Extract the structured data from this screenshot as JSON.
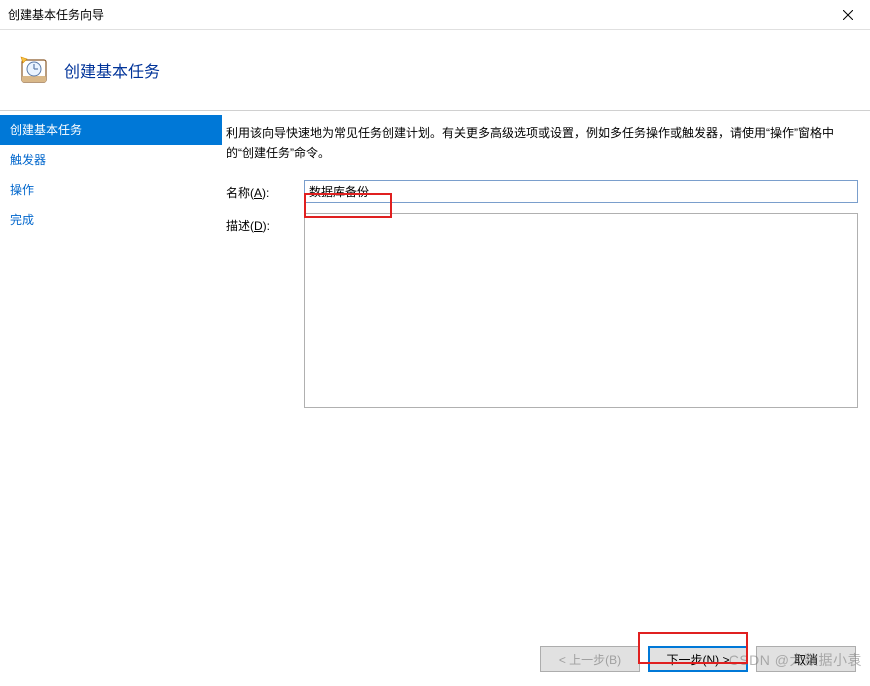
{
  "window": {
    "title": "创建基本任务向导"
  },
  "header": {
    "title": "创建基本任务"
  },
  "sidebar": {
    "items": [
      {
        "label": "创建基本任务"
      },
      {
        "label": "触发器"
      },
      {
        "label": "操作"
      },
      {
        "label": "完成"
      }
    ]
  },
  "main": {
    "intro": "利用该向导快速地为常见任务创建计划。有关更多高级选项或设置，例如多任务操作或触发器，请使用“操作”窗格中的“创建任务”命令。",
    "nameLabelPrefix": "名称(",
    "nameLabelKey": "A",
    "nameLabelSuffix": "):",
    "nameValue": "数据库备份",
    "descLabelPrefix": "描述(",
    "descLabelKey": "D",
    "descLabelSuffix": "):",
    "descValue": ""
  },
  "footer": {
    "back": "< 上一步(B)",
    "next": "下一步(N) >",
    "cancel": "取消"
  },
  "watermark": "CSDN @大数据小袁"
}
